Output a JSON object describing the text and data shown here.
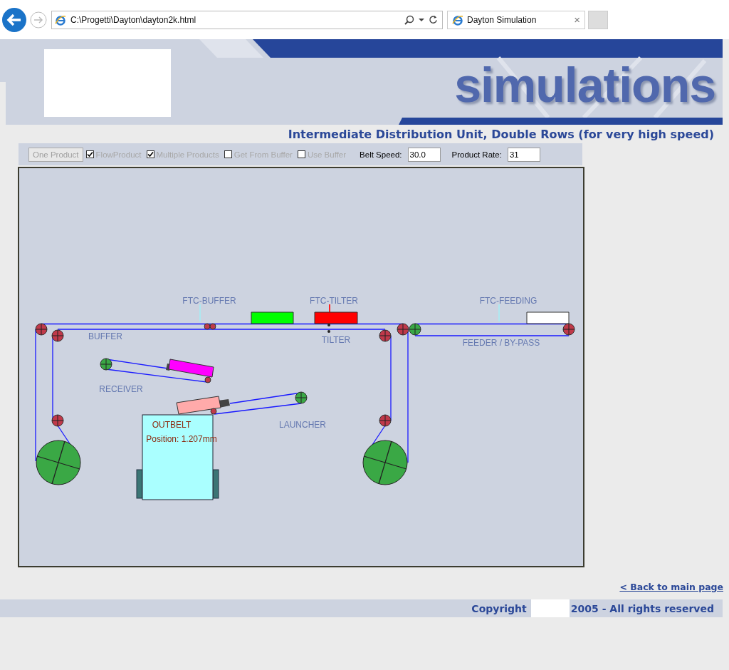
{
  "browser": {
    "address": "C:\\Progetti\\Dayton\\dayton2k.html",
    "tab": {
      "title": "Dayton Simulation",
      "close": "×"
    }
  },
  "header": {
    "brand": "simulations",
    "title": "Intermediate Distribution Unit, Double Rows (for very high speed)"
  },
  "controls": {
    "button": {
      "label": "One Product",
      "disabled": true
    },
    "checkboxes": [
      {
        "label": "FlowProduct",
        "checked": true,
        "disabled": true
      },
      {
        "label": "Multiple Products",
        "checked": true,
        "disabled": true
      },
      {
        "label": "Get From Buffer",
        "checked": false,
        "disabled": true
      },
      {
        "label": "Use Buffer",
        "checked": false,
        "disabled": true
      }
    ],
    "fields": [
      {
        "label": "Belt Speed:",
        "value": "30.0"
      },
      {
        "label": "Product Rate:",
        "value": "31"
      }
    ]
  },
  "diagram": {
    "labels": [
      {
        "text": "FTC-BUFFER",
        "kind": "label"
      },
      {
        "text": "FTC-TILTER",
        "kind": "label"
      },
      {
        "text": "FTC-FEEDING",
        "kind": "label"
      },
      {
        "text": "BUFFER",
        "kind": "label"
      },
      {
        "text": "TILTER",
        "kind": "label"
      },
      {
        "text": "FEEDER / BY-PASS",
        "kind": "label"
      },
      {
        "text": "RECEIVER",
        "kind": "label"
      },
      {
        "text": "LAUNCHER",
        "kind": "label"
      },
      {
        "text": "OUTBELT",
        "kind": "status"
      },
      {
        "text": "Position: 1.207mm",
        "kind": "status"
      }
    ],
    "products": [
      {
        "color": "#00ff00"
      },
      {
        "color": "#ff0000"
      },
      {
        "color": "#ffffff"
      },
      {
        "color": "#ff00ff"
      },
      {
        "color": "#ffaaaa"
      }
    ]
  },
  "footer": {
    "back_link": "< Back to main page",
    "copyright": "Copyright",
    "rights": "2005 - All rights reserved"
  }
}
